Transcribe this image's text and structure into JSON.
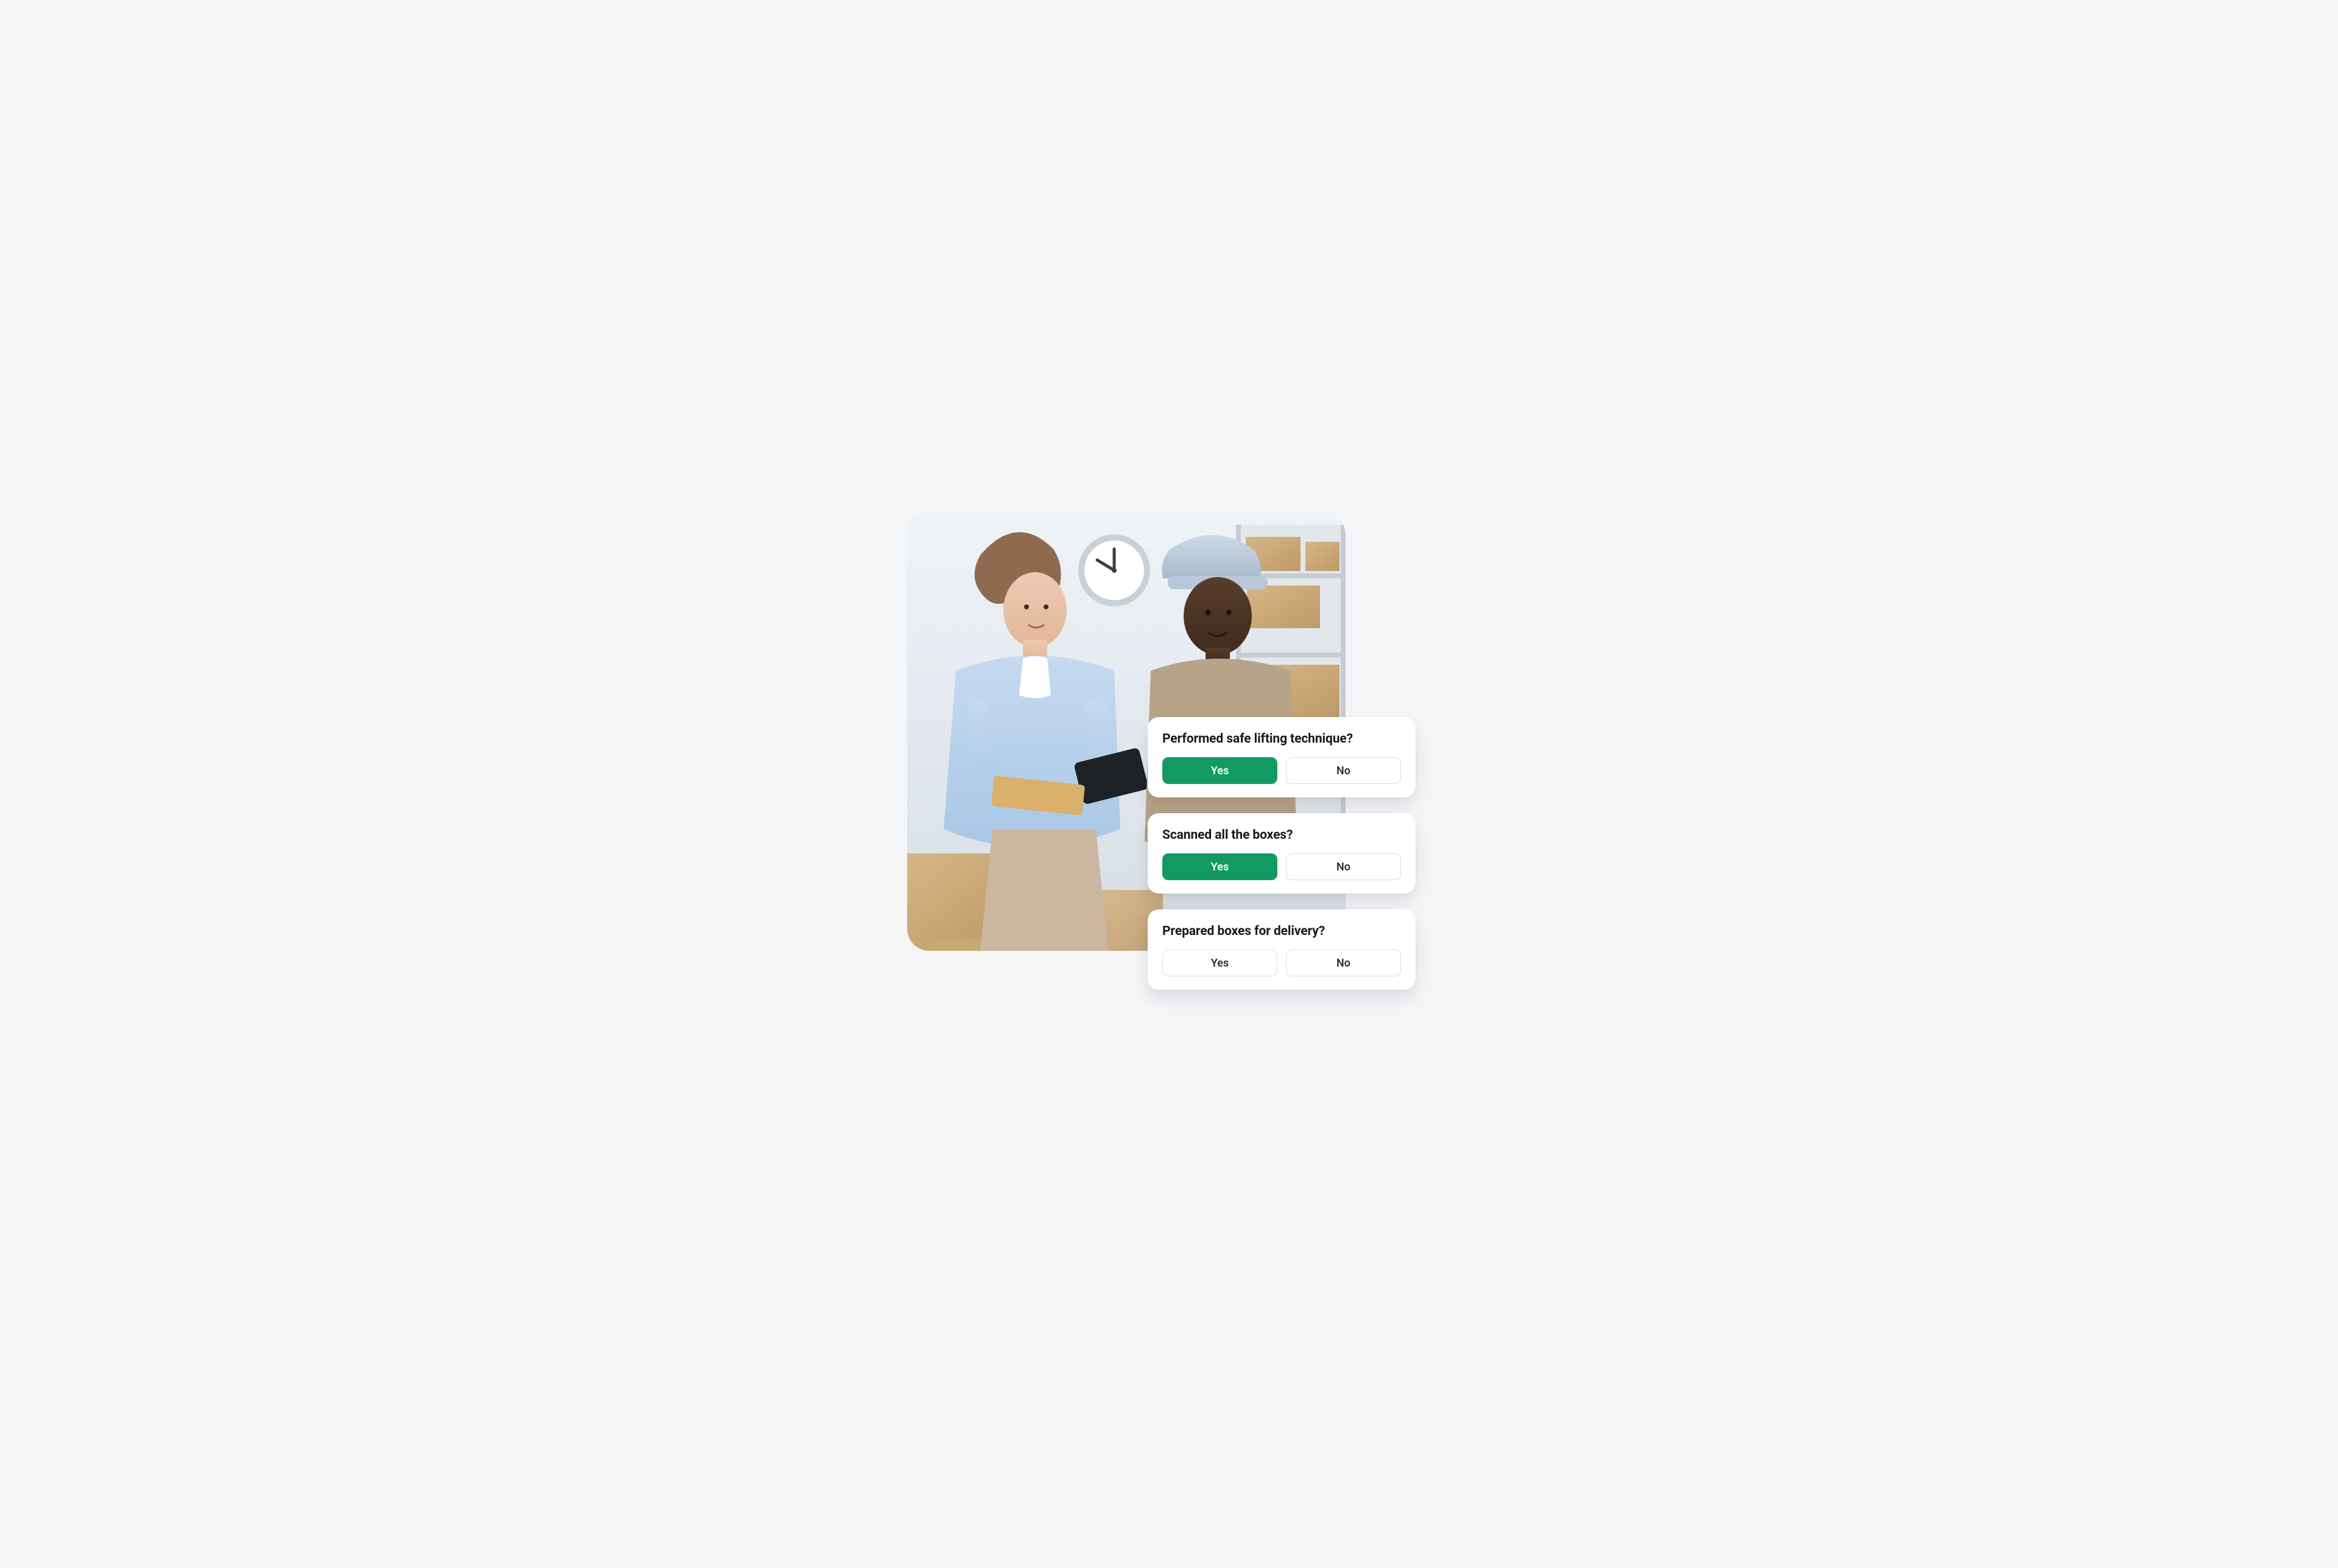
{
  "image_alt": "Two warehouse workers handling packages; one scans a box with a handheld scanner while the other holds a tablet and envelopes; wall clock and shelving with boxes in background.",
  "questions": [
    {
      "prompt": "Performed safe lifting technique?",
      "yes": "Yes",
      "no": "No",
      "selected": "yes"
    },
    {
      "prompt": "Scanned all the boxes?",
      "yes": "Yes",
      "no": "No",
      "selected": "yes"
    },
    {
      "prompt": "Prepared boxes for delivery?",
      "yes": "Yes",
      "no": "No",
      "selected": null
    }
  ],
  "colors": {
    "accent_green": "#139a63",
    "card_bg": "#ffffff",
    "page_bg": "#f3f5f7",
    "border": "#d7dde2",
    "text": "#171a1c"
  }
}
